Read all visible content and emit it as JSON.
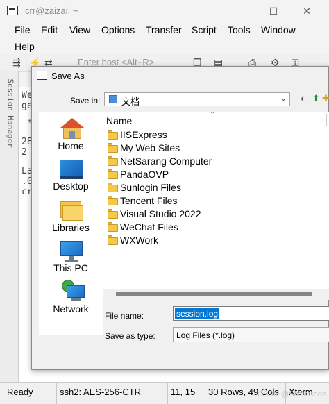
{
  "window": {
    "title": "crr@zaizai: ~",
    "minimize": "—",
    "maximize": "☐",
    "close": "✕"
  },
  "menu": [
    "File",
    "Edit",
    "View",
    "Options",
    "Transfer",
    "Script",
    "Tools",
    "Window",
    "Help"
  ],
  "toolbar": {
    "host_placeholder": "Enter host <Alt+R>"
  },
  "sidebar": {
    "tab_label": "Session Manager"
  },
  "terminal": {
    "lines": [
      "We",
      "ge",
      "*",
      "28",
      "2",
      "La",
      ".0",
      "cr"
    ]
  },
  "dialog": {
    "title": "Save As",
    "save_in_label": "Save in:",
    "save_in_value": "文档",
    "places": [
      "Home",
      "Desktop",
      "Libraries",
      "This PC",
      "Network"
    ],
    "column_name": "Name",
    "files": [
      "IISExpress",
      "My Web Sites",
      "NetSarang Computer",
      "PandaOVP",
      "Sunlogin Files",
      "Tencent Files",
      "Visual Studio 2022",
      "WeChat Files",
      "WXWork"
    ],
    "file_name_label": "File name:",
    "file_name_value": "session.log",
    "save_as_type_label": "Save as type:",
    "save_as_type_value": "Log Files (*.log)"
  },
  "status": {
    "ready": "Ready",
    "cipher": "ssh2: AES-256-CTR",
    "cursor": "11, 15",
    "size": "30 Rows, 49 Cols",
    "term": "Xterm",
    "watermark": "CSDN @ScalaCode"
  }
}
